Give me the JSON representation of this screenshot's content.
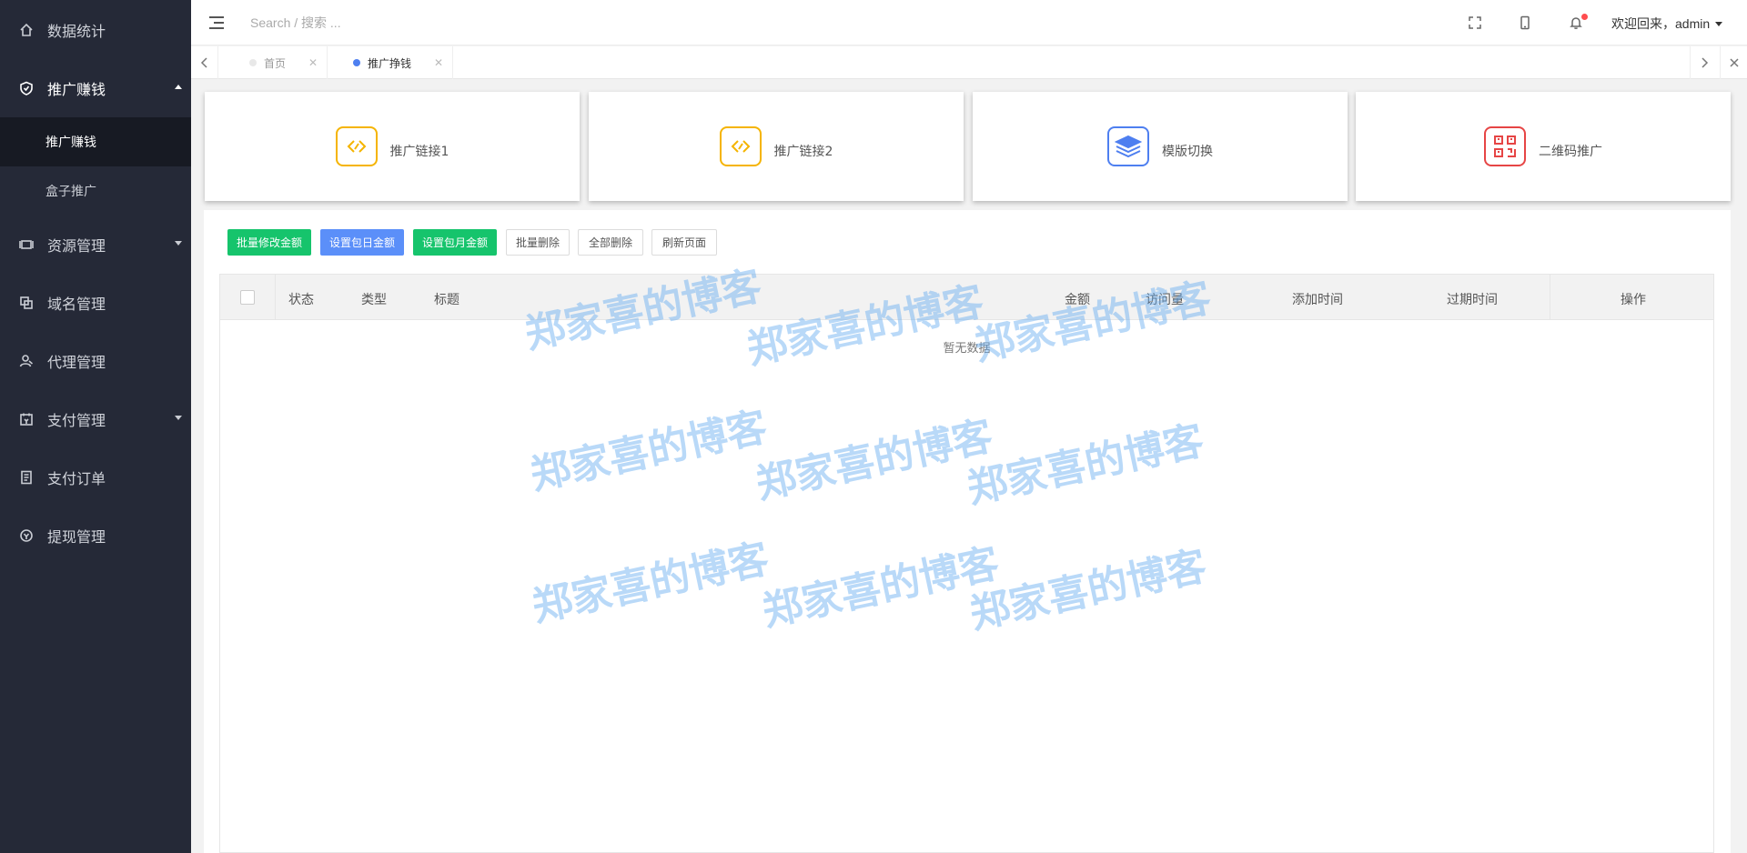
{
  "sidebar": {
    "items": [
      {
        "label": "数据统计",
        "icon": "home-icon"
      },
      {
        "label": "推广赚钱",
        "icon": "shield-icon",
        "active": true
      },
      {
        "label": "资源管理",
        "icon": "resource-icon"
      },
      {
        "label": "域名管理",
        "icon": "copy-icon"
      },
      {
        "label": "代理管理",
        "icon": "user-icon"
      },
      {
        "label": "支付管理",
        "icon": "calendar-icon"
      },
      {
        "label": "支付订单",
        "icon": "order-icon"
      },
      {
        "label": "提现管理",
        "icon": "withdraw-icon"
      }
    ],
    "sub_items": [
      {
        "label": "推广赚钱",
        "active": true
      },
      {
        "label": "盒子推广"
      }
    ]
  },
  "header": {
    "search_placeholder": "Search / 搜索 ...",
    "welcome": "欢迎回来，admin"
  },
  "tabs": [
    {
      "label": "首页"
    },
    {
      "label": "推广挣钱",
      "active": true
    }
  ],
  "cards": [
    {
      "label": "推广链接1",
      "icon": "link-icon",
      "color": "#f5b400"
    },
    {
      "label": "推广链接2",
      "icon": "link-icon",
      "color": "#f5b400"
    },
    {
      "label": "模版切换",
      "icon": "layers-icon",
      "color": "#4e7ff0"
    },
    {
      "label": "二维码推广",
      "icon": "qrcode-icon",
      "color": "#e64545"
    }
  ],
  "toolbar": {
    "batch_edit_amount": "批量修改金额",
    "set_daily_amount": "设置包日金额",
    "set_monthly_amount": "设置包月金额",
    "batch_delete": "批量删除",
    "delete_all": "全部删除",
    "refresh_page": "刷新页面"
  },
  "table": {
    "columns": [
      "状态",
      "类型",
      "标题",
      "金额",
      "访问量",
      "添加时间",
      "过期时间",
      "操作"
    ],
    "empty_text": "暂无数据"
  },
  "watermark": "郑家喜的博客",
  "colors": {
    "sidebar_bg": "#252937",
    "green": "#16c46c",
    "blue": "#5b8ff9"
  }
}
